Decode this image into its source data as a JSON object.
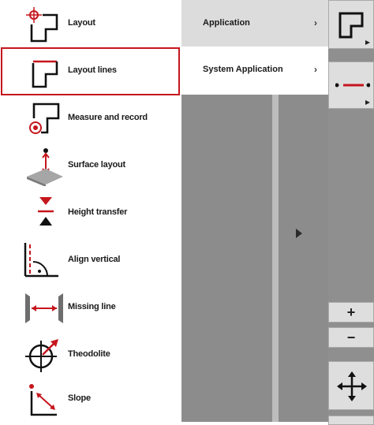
{
  "menu": {
    "items": [
      {
        "label": "Layout",
        "icon": "layout-icon"
      },
      {
        "label": "Layout lines",
        "icon": "layout-lines-icon"
      },
      {
        "label": "Measure and record",
        "icon": "measure-record-icon"
      },
      {
        "label": "Surface layout",
        "icon": "surface-layout-icon"
      },
      {
        "label": "Height transfer",
        "icon": "height-transfer-icon"
      },
      {
        "label": "Align vertical",
        "icon": "align-vertical-icon"
      },
      {
        "label": "Missing line",
        "icon": "missing-line-icon"
      },
      {
        "label": "Theodolite",
        "icon": "theodolite-icon"
      },
      {
        "label": "Slope",
        "icon": "slope-icon"
      }
    ],
    "selected": "Layout lines"
  },
  "submenu": {
    "items": [
      {
        "label": "Application",
        "chevron": "›"
      },
      {
        "label": "System Application",
        "chevron": "›"
      }
    ],
    "active": "Application"
  },
  "right_panel": {
    "zoom_in": "+",
    "zoom_out": "−"
  },
  "colors": {
    "accent": "#c5161d",
    "text": "#1a1a1a"
  }
}
